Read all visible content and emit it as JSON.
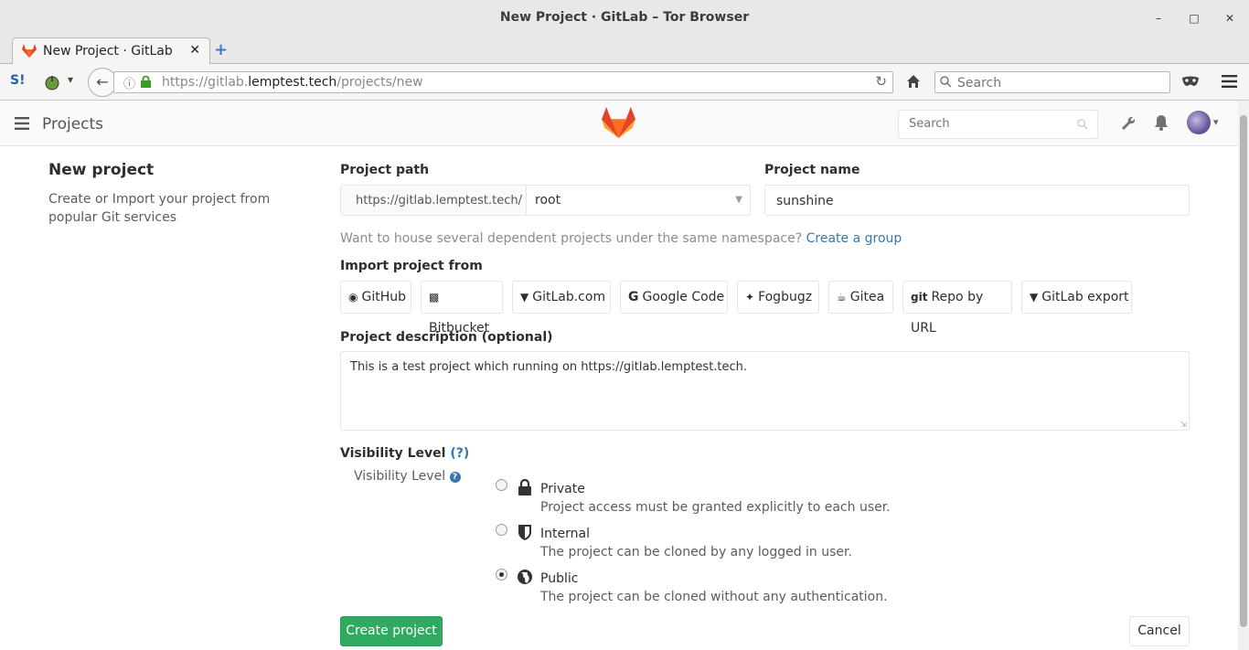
{
  "window": {
    "title": "New Project · GitLab – Tor Browser"
  },
  "tab": {
    "label": "New Project · GitLab"
  },
  "browser": {
    "url_prefix": "https://gitlab.",
    "url_domain": "lemptest.tech",
    "url_path": "/projects/new",
    "search_placeholder": "Search"
  },
  "gitlab_header": {
    "title": "Projects",
    "search_placeholder": "Search"
  },
  "sidebar": {
    "heading": "New project",
    "description": "Create or Import your project from popular Git services"
  },
  "form": {
    "path_label": "Project path",
    "path_prefix": "https://gitlab.lemptest.tech/",
    "namespace": "root",
    "name_label": "Project name",
    "name_value": "sunshine",
    "group_hint": "Want to house several dependent projects under the same namespace?",
    "group_link": "Create a group",
    "import_label": "Import project from",
    "import_options": [
      "GitHub",
      "Bitbucket",
      "GitLab.com",
      "Google Code",
      "Fogbugz",
      "Gitea",
      "Repo by URL",
      "GitLab export"
    ],
    "description_label": "Project description (optional)",
    "description_value": "This is a test project which running on https://gitlab.lemptest.tech.",
    "visibility_heading": "Visibility Level",
    "visibility_help": "(?)",
    "visibility_label": "Visibility Level",
    "visibility_options": [
      {
        "title": "Private",
        "desc": "Project access must be granted explicitly to each user.",
        "icon": "lock-icon",
        "selected": false
      },
      {
        "title": "Internal",
        "desc": "The project can be cloned by any logged in user.",
        "icon": "shield-icon",
        "selected": false
      },
      {
        "title": "Public",
        "desc": "The project can be cloned without any authentication.",
        "icon": "globe-icon",
        "selected": true
      }
    ],
    "create_label": "Create project",
    "cancel_label": "Cancel"
  },
  "colors": {
    "accent": "#2faa60",
    "link": "#3777b0",
    "logo": "#e24329"
  }
}
